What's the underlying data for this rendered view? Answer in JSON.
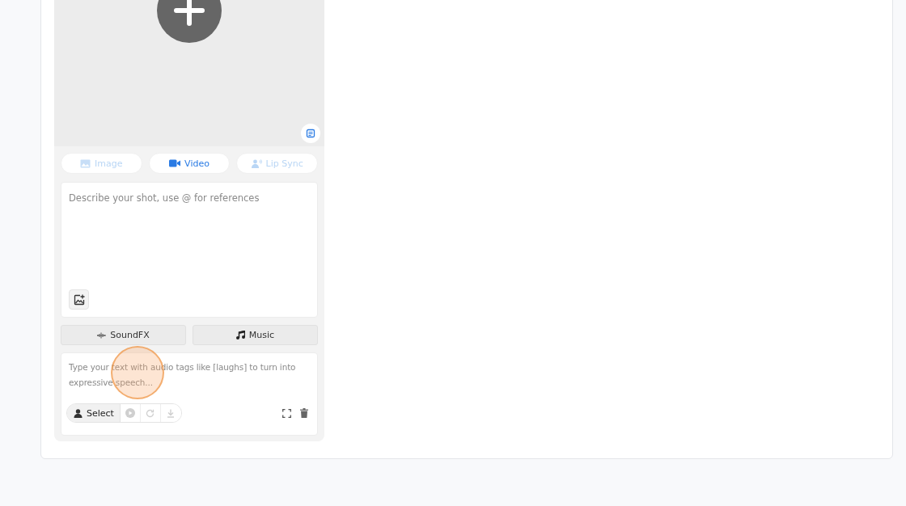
{
  "modes": [
    {
      "kind": "image",
      "label": "Image",
      "selected": false
    },
    {
      "kind": "video",
      "label": "Video",
      "selected": true
    },
    {
      "kind": "lipsync",
      "label": "Lip Sync",
      "selected": false
    }
  ],
  "prompt": {
    "placeholder": "Describe your shot, use @ for references"
  },
  "audio_tabs": [
    {
      "kind": "soundfx",
      "label": "SoundFX"
    },
    {
      "kind": "music",
      "label": "Music"
    }
  ],
  "speech": {
    "placeholder": "Type your text with audio tags like [laughs] to turn into expressive speech..."
  },
  "voice_button": {
    "label": "Select"
  },
  "player_controls": [
    {
      "kind": "play",
      "disabled": true
    },
    {
      "kind": "regenerate",
      "disabled": true
    },
    {
      "kind": "download",
      "disabled": true
    }
  ]
}
